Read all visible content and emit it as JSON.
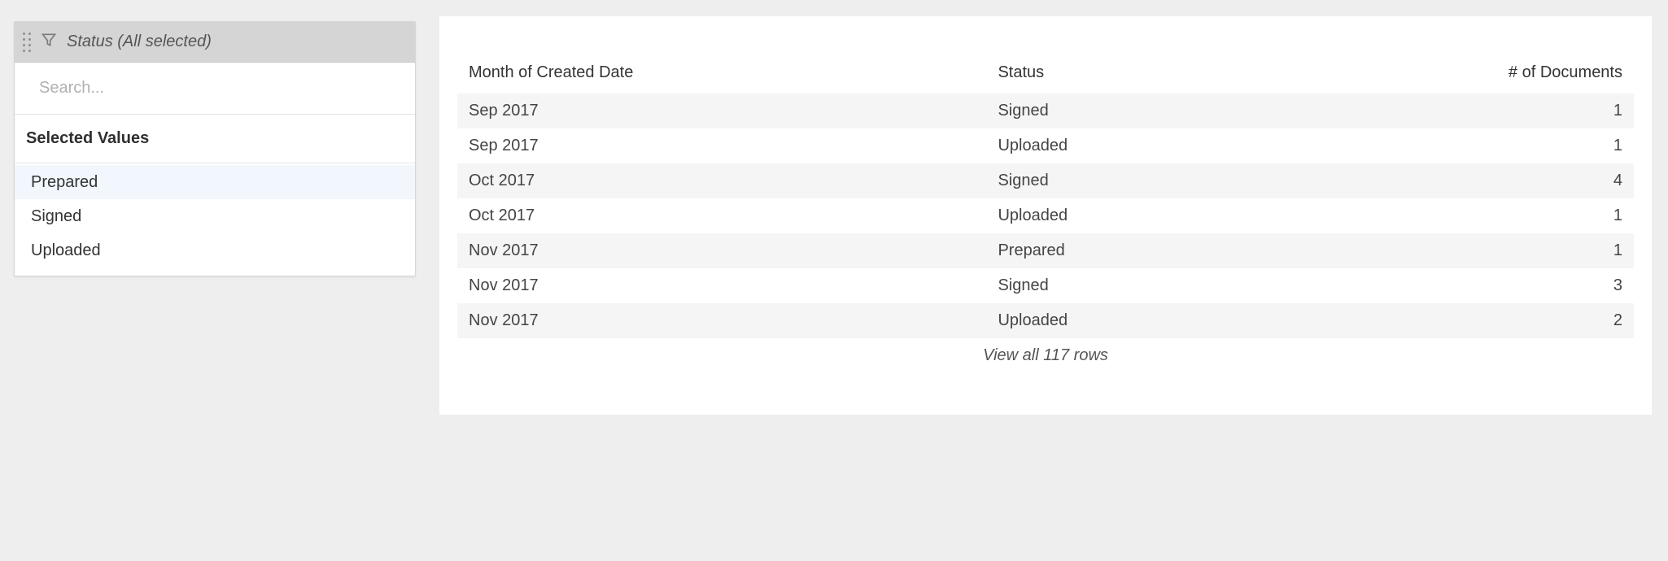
{
  "filter": {
    "title": "Status (All selected)",
    "search_placeholder": "Search...",
    "selected_heading": "Selected Values",
    "values": [
      "Prepared",
      "Signed",
      "Uploaded"
    ],
    "highlight_index": 0
  },
  "table": {
    "columns": [
      "Month of Created Date",
      "Status",
      "# of Documents"
    ],
    "rows": [
      {
        "month": "Sep 2017",
        "status": "Signed",
        "count": 1
      },
      {
        "month": "Sep 2017",
        "status": "Uploaded",
        "count": 1
      },
      {
        "month": "Oct 2017",
        "status": "Signed",
        "count": 4
      },
      {
        "month": "Oct 2017",
        "status": "Uploaded",
        "count": 1
      },
      {
        "month": "Nov 2017",
        "status": "Prepared",
        "count": 1
      },
      {
        "month": "Nov 2017",
        "status": "Signed",
        "count": 3
      },
      {
        "month": "Nov 2017",
        "status": "Uploaded",
        "count": 2
      }
    ],
    "view_all": "View all 117 rows"
  }
}
